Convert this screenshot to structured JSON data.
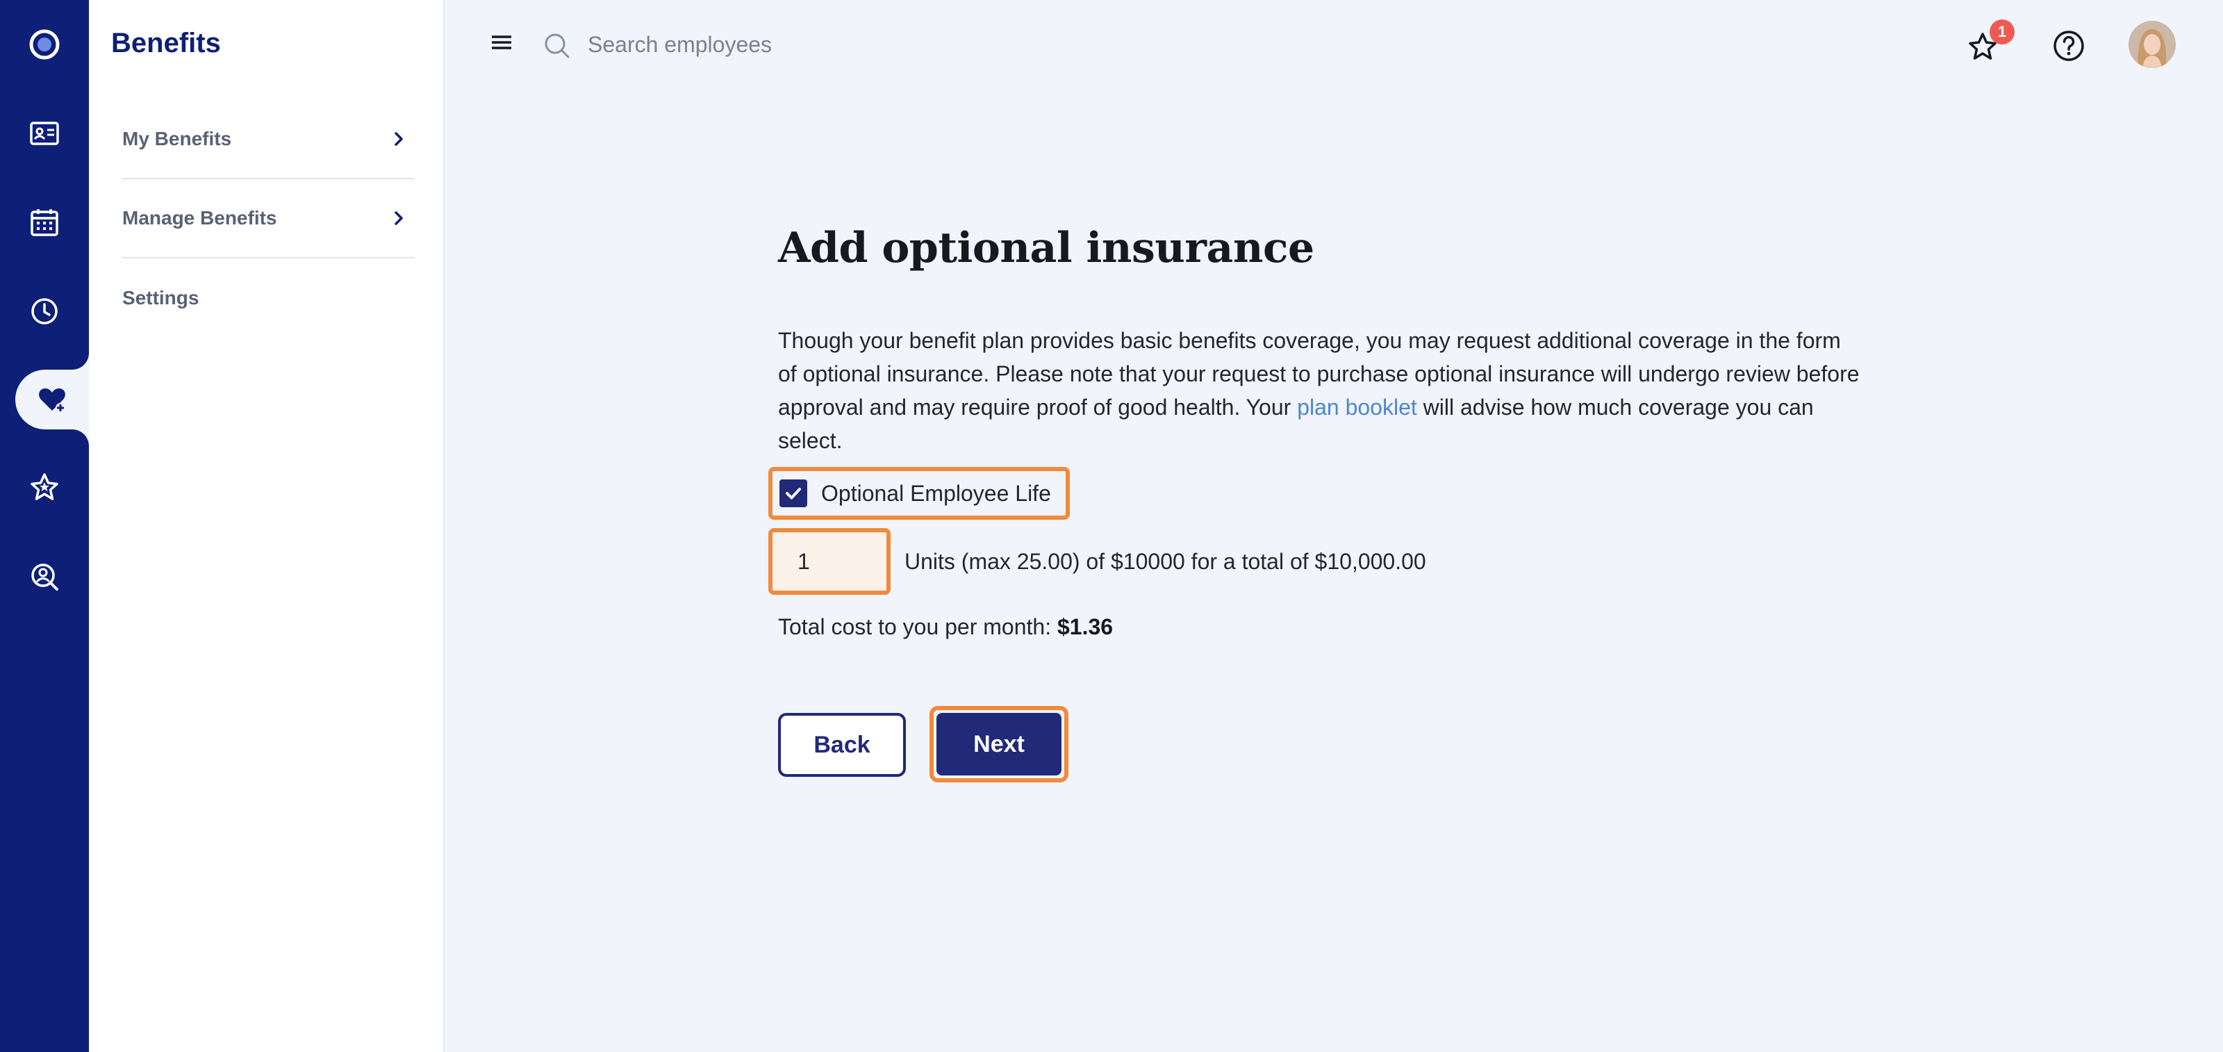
{
  "app": {
    "section_title": "Benefits"
  },
  "rail": {
    "items": [
      {
        "icon": "logo-icon"
      },
      {
        "icon": "id-card-icon"
      },
      {
        "icon": "calendar-icon"
      },
      {
        "icon": "clock-icon"
      },
      {
        "icon": "heart-plus-icon",
        "active": true
      },
      {
        "icon": "star-icon"
      },
      {
        "icon": "person-search-icon"
      }
    ]
  },
  "sidebar": {
    "items": [
      {
        "label": "My Benefits",
        "has_chevron": true
      },
      {
        "label": "Manage Benefits",
        "has_chevron": true
      },
      {
        "label": "Settings",
        "has_chevron": false
      }
    ]
  },
  "topbar": {
    "search_placeholder": "Search employees",
    "notification_count": "1"
  },
  "main": {
    "title": "Add optional insurance",
    "intro_before_link": "Though your benefit plan provides basic benefits coverage, you may request additional coverage in the form of optional insurance. Please note that your request to purchase optional insurance will undergo review before approval and may require proof of good health. Your ",
    "intro_link": "plan booklet",
    "intro_after_link": " will advise how much coverage you can select.",
    "option_label": "Optional Employee Life",
    "option_checked": true,
    "units_value": "1",
    "units_text": "Units (max 25.00) of $10000 for a total of $10,000.00",
    "cost_label": "Total cost to you per month: ",
    "cost_value": "$1.36",
    "back_label": "Back",
    "next_label": "Next"
  },
  "colors": {
    "rail": "#0e1f78",
    "primary": "#212a78",
    "highlight": "#f08a3c",
    "link": "#4a86d6",
    "badge": "#ee5a52",
    "background": "#f1f4fb"
  }
}
